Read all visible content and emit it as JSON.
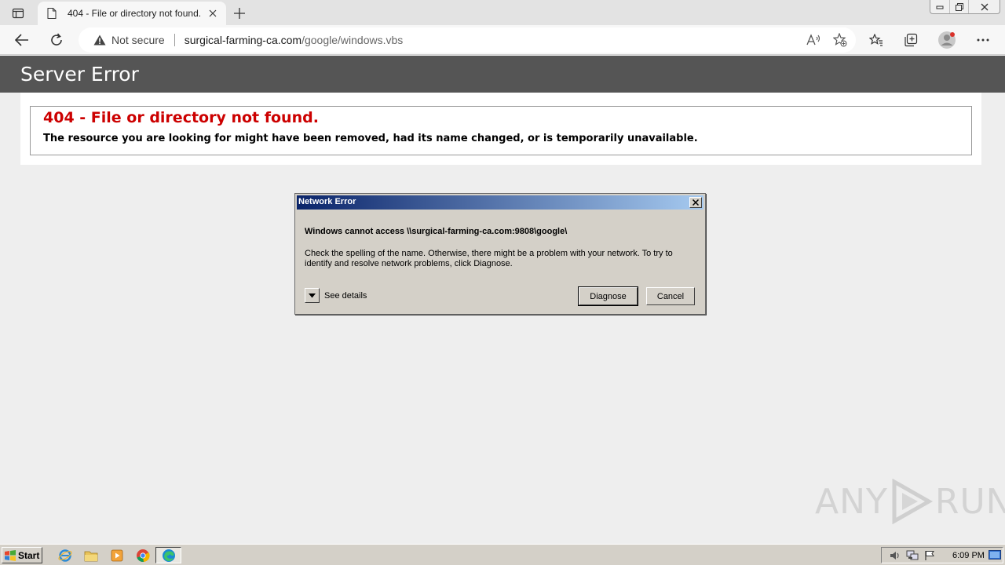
{
  "browser": {
    "tab_title": "404 - File or directory not found.",
    "address": {
      "security_label": "Not secure",
      "url_host": "surgical-farming-ca.com",
      "url_path": "/google/windows.vbs"
    }
  },
  "page": {
    "header_title": "Server Error",
    "error_heading": "404 - File or directory not found.",
    "error_message": "The resource you are looking for might have been removed, had its name changed, or is temporarily unavailable."
  },
  "dialog": {
    "title": "Network Error",
    "main_text": "Windows cannot access \\\\surgical-farming-ca.com:9808\\google\\",
    "sub_text": "Check the spelling of the name. Otherwise, there might be a problem with your network. To try to identify and resolve network problems, click Diagnose.",
    "details_label": "See details",
    "diagnose_label": "Diagnose",
    "cancel_label": "Cancel"
  },
  "watermark": {
    "left": "ANY",
    "right": "RUN"
  },
  "taskbar": {
    "start_label": "Start",
    "clock": "6:09 PM"
  },
  "colors": {
    "header_bg": "#555555",
    "error_red": "#cc0000",
    "dialog_bg": "#d4d0c8",
    "title_gradient_start": "#0a246a",
    "title_gradient_end": "#a6caf0"
  }
}
